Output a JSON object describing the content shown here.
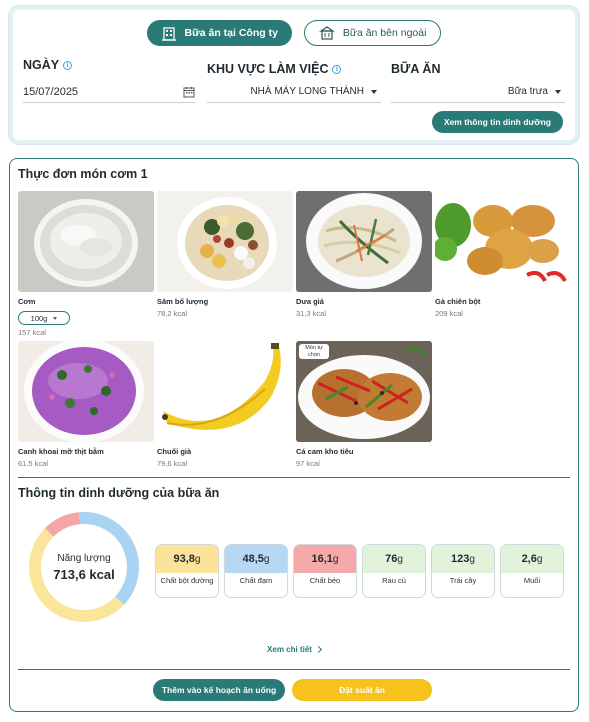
{
  "tabs": [
    {
      "label": "Bữa ăn tại Công ty",
      "icon": "company-building-icon",
      "active": true
    },
    {
      "label": "Bữa ăn bên ngoài",
      "icon": "restaurant-icon",
      "active": false
    }
  ],
  "filters": {
    "date_label": "NGÀY",
    "date_value": "15/07/2025",
    "area_label": "KHU VỰC LÀM VIỆC",
    "area_value": "NHÀ MÁY LONG THÀNH",
    "meal_label": "BỮA ĂN",
    "meal_value": "Bữa trưa",
    "nutrition_button": "Xem thông tin dinh dưỡng"
  },
  "menu": {
    "title": "Thực đơn món cơm 1",
    "dishes": [
      {
        "name": "Cơm",
        "kcal": "157 kcal",
        "portion": "100g",
        "image": "rice-bowl"
      },
      {
        "name": "Sâm bổ lượng",
        "kcal": "78,2 kcal",
        "image": "sweet-soup"
      },
      {
        "name": "Dưa giá",
        "kcal": "31,3 kcal",
        "image": "pickled-sprouts"
      },
      {
        "name": "Gà chiên bột",
        "kcal": "209 kcal",
        "image": "fried-chicken"
      },
      {
        "name": "Canh khoai mỡ thịt bằm",
        "kcal": "61,5 kcal",
        "image": "purple-yam-soup"
      },
      {
        "name": "Chuối già",
        "kcal": "79,6 kcal",
        "image": "banana"
      },
      {
        "name": "Cá cam kho tiêu",
        "kcal": "97 kcal",
        "badge": "Món tự chọn",
        "image": "braised-fish"
      }
    ]
  },
  "nutrition": {
    "title": "Thông tin dinh dưỡng của bữa ăn",
    "energy_label": "Năng lượng",
    "energy_value": "713,6 kcal",
    "items": [
      {
        "value": "93,8",
        "unit": "g",
        "label": "Chất bột đường",
        "color": "#fbe49a"
      },
      {
        "value": "48,5",
        "unit": "g",
        "label": "Chất đạm",
        "color": "#b6d8f5"
      },
      {
        "value": "16,1",
        "unit": "g",
        "label": "Chất béo",
        "color": "#f6a9a9"
      },
      {
        "value": "76",
        "unit": "g",
        "label": "Rau củ",
        "color": "#e2f3dc"
      },
      {
        "value": "123",
        "unit": "g",
        "label": "Trái cây",
        "color": "#e2f3dc"
      },
      {
        "value": "2,6",
        "unit": "g",
        "label": "Muối",
        "color": "#e2f3dc"
      }
    ],
    "detail_link": "Xem chi tiết"
  },
  "actions": {
    "add_plan": "Thêm vào kế hoạch ăn uống",
    "order": "Đặt suất ăn"
  },
  "colors": {
    "primary": "#2a7a78",
    "accent": "#f6c21b",
    "donut_blue": "#a8d3f2",
    "donut_yellow": "#fae59a",
    "donut_red": "#f4a5a5"
  }
}
